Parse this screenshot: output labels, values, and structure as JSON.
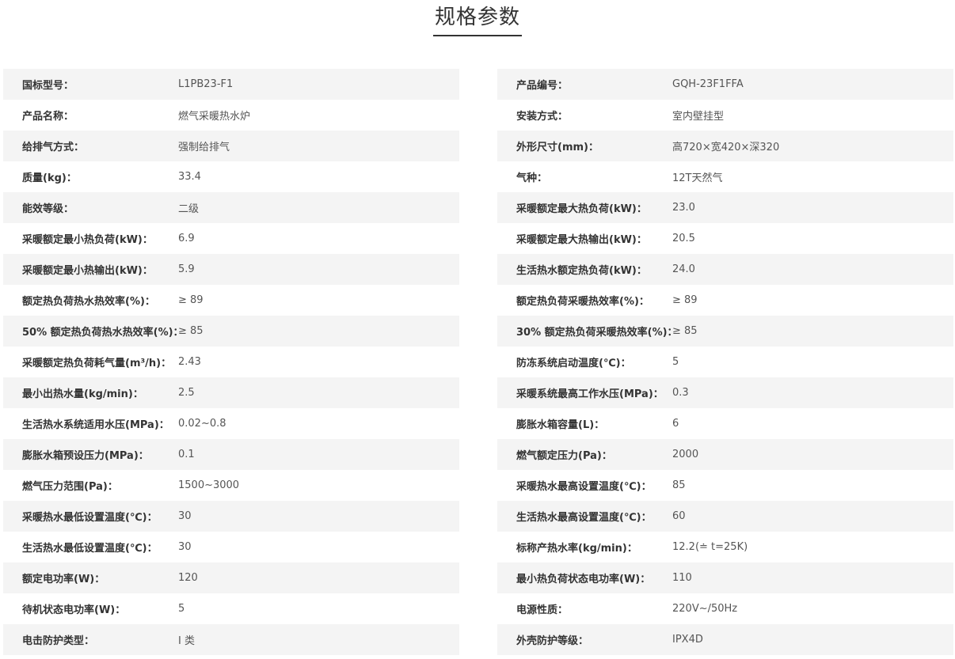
{
  "title": "规格参数",
  "left": [
    {
      "label": "国标型号：",
      "value": "L1PB23-F1"
    },
    {
      "label": "产品名称：",
      "value": "燃气采暖热水炉"
    },
    {
      "label": "给排气方式：",
      "value": "强制给排气"
    },
    {
      "label": "质量(kg)：",
      "value": "33.4"
    },
    {
      "label": "能效等级：",
      "value": "二级"
    },
    {
      "label": "采暖额定最小热负荷(kW)：",
      "value": "6.9"
    },
    {
      "label": "采暖额定最小热输出(kW)：",
      "value": "5.9"
    },
    {
      "label": "额定热负荷热水热效率(%)：",
      "value": "≥ 89"
    },
    {
      "label": "50% 额定热负荷热水热效率(%)：",
      "value": "≥ 85"
    },
    {
      "label": "采暖额定热负荷耗气量(m³/h)：",
      "value": "2.43"
    },
    {
      "label": "最小出热水量(kg/min)：",
      "value": "2.5"
    },
    {
      "label": "生活热水系统适用水压(MPa)：",
      "value": "0.02~0.8"
    },
    {
      "label": "膨胀水箱预设压力(MPa)：",
      "value": "0.1"
    },
    {
      "label": "燃气压力范围(Pa)：",
      "value": "1500~3000"
    },
    {
      "label": "采暖热水最低设置温度(℃)：",
      "value": "30"
    },
    {
      "label": "生活热水最低设置温度(℃)：",
      "value": "30"
    },
    {
      "label": "额定电功率(W)：",
      "value": "120"
    },
    {
      "label": "待机状态电功率(W)：",
      "value": "5"
    },
    {
      "label": "电击防护类型：",
      "value": "I 类"
    }
  ],
  "right": [
    {
      "label": "产品编号：",
      "value": "GQH-23F1FFA"
    },
    {
      "label": "安装方式：",
      "value": "室内壁挂型"
    },
    {
      "label": "外形尺寸(mm)：",
      "value": "高720×宽420×深320"
    },
    {
      "label": "气种：",
      "value": "12T天然气"
    },
    {
      "label": "采暖额定最大热负荷(kW)：",
      "value": "23.0"
    },
    {
      "label": "采暖额定最大热输出(kW)：",
      "value": "20.5"
    },
    {
      "label": "生活热水额定热负荷(kW)：",
      "value": "24.0"
    },
    {
      "label": "额定热负荷采暖热效率(%)：",
      "value": "≥ 89"
    },
    {
      "label": "30% 额定热负荷采暖热效率(%)：",
      "value": "≥ 85"
    },
    {
      "label": "防冻系统启动温度(℃)：",
      "value": "5"
    },
    {
      "label": "采暖系统最高工作水压(MPa)：",
      "value": "0.3"
    },
    {
      "label": "膨胀水箱容量(L)：",
      "value": "6"
    },
    {
      "label": "燃气额定压力(Pa)：",
      "value": "2000"
    },
    {
      "label": "采暖热水最高设置温度(℃)：",
      "value": "85"
    },
    {
      "label": "生活热水最高设置温度(℃)：",
      "value": "60"
    },
    {
      "label": "标称产热水率(kg/min)：",
      "value": "12.2(≐ t=25K)"
    },
    {
      "label": "最小热负荷状态电功率(W)：",
      "value": "110"
    },
    {
      "label": "电源性质：",
      "value": "220V~/50Hz"
    },
    {
      "label": "外壳防护等级：",
      "value": "IPX4D"
    }
  ]
}
